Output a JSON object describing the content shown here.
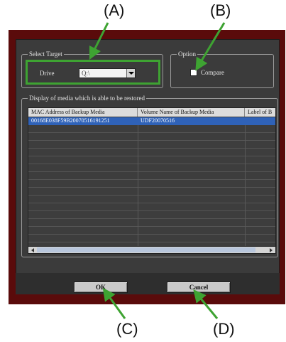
{
  "callouts": {
    "a": "(A)",
    "b": "(B)",
    "c": "(C)",
    "d": "(D)"
  },
  "select_target": {
    "legend": "Select Target",
    "drive_label": "Drive",
    "drive_value": "Q:\\"
  },
  "option": {
    "legend": "Option",
    "compare_label": "Compare"
  },
  "media_list": {
    "legend": "Display of media which is able to be restored",
    "columns": [
      "MAC Address of Backup Media",
      "Volume Name of Backup Media",
      "Label of B"
    ],
    "rows": [
      [
        "00168E038F59B20070516191251",
        "UDF20070516",
        ""
      ]
    ]
  },
  "buttons": {
    "ok": "OK",
    "cancel": "Cancel"
  },
  "colors": {
    "annotation": "#3ea332",
    "selection": "#2f62b8",
    "frame": "#5a0b0b"
  }
}
